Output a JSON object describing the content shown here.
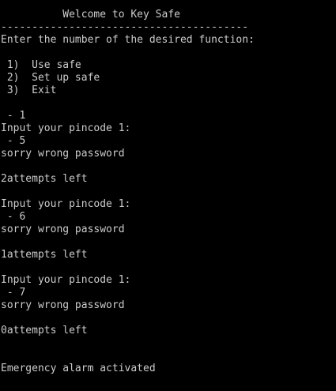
{
  "console": {
    "lines": [
      "          Welcome to Key Safe",
      "----------------------------------------",
      "Enter the number of the desired function:",
      "",
      " 1)  Use safe",
      " 2)  Set up safe",
      " 3)  Exit",
      "",
      " - 1",
      "Input your pincode 1:",
      " - 5",
      "sorry wrong password",
      "",
      "2attempts left",
      "",
      "Input your pincode 1:",
      " - 6",
      "sorry wrong password",
      "",
      "1attempts left",
      "",
      "Input your pincode 1:",
      " - 7",
      "sorry wrong password",
      "",
      "0attempts left",
      "",
      "",
      "Emergency alarm activated"
    ]
  }
}
